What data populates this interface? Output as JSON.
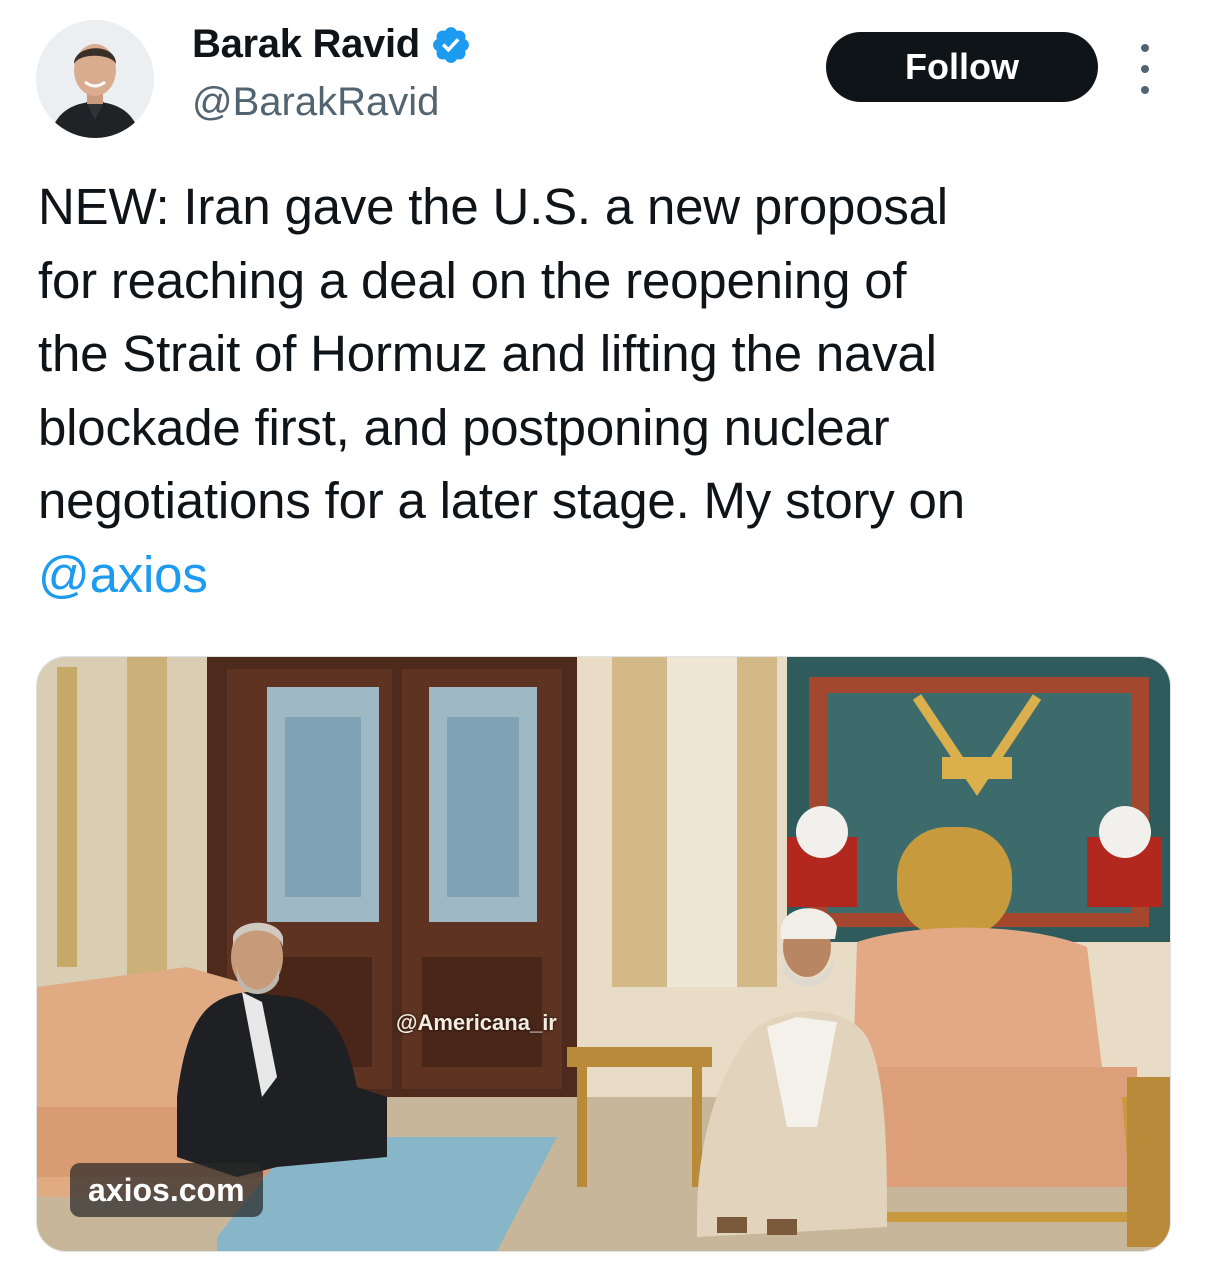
{
  "author": {
    "display_name": "Barak Ravid",
    "handle": "@BarakRavid",
    "verified": true,
    "avatar_icon": "profile-photo"
  },
  "actions": {
    "follow_label": "Follow",
    "more_icon": "more-vertical-icon"
  },
  "tweet": {
    "lines": [
      "NEW: Iran gave the U.S. a new proposal",
      "for reaching a deal on the reopening of",
      "the Strait of Hormuz and lifting the naval",
      "blockade first, and postponing nuclear",
      "negotiations for a later stage. My story on"
    ],
    "mention": "@axios"
  },
  "media": {
    "link_domain": "axios.com",
    "watermark": "@Americana_ir"
  },
  "colors": {
    "text": "#0f1419",
    "secondary": "#536471",
    "link": "#1d9bf0",
    "verified": "#1d9bf0",
    "follow_bg": "#0f1419"
  }
}
